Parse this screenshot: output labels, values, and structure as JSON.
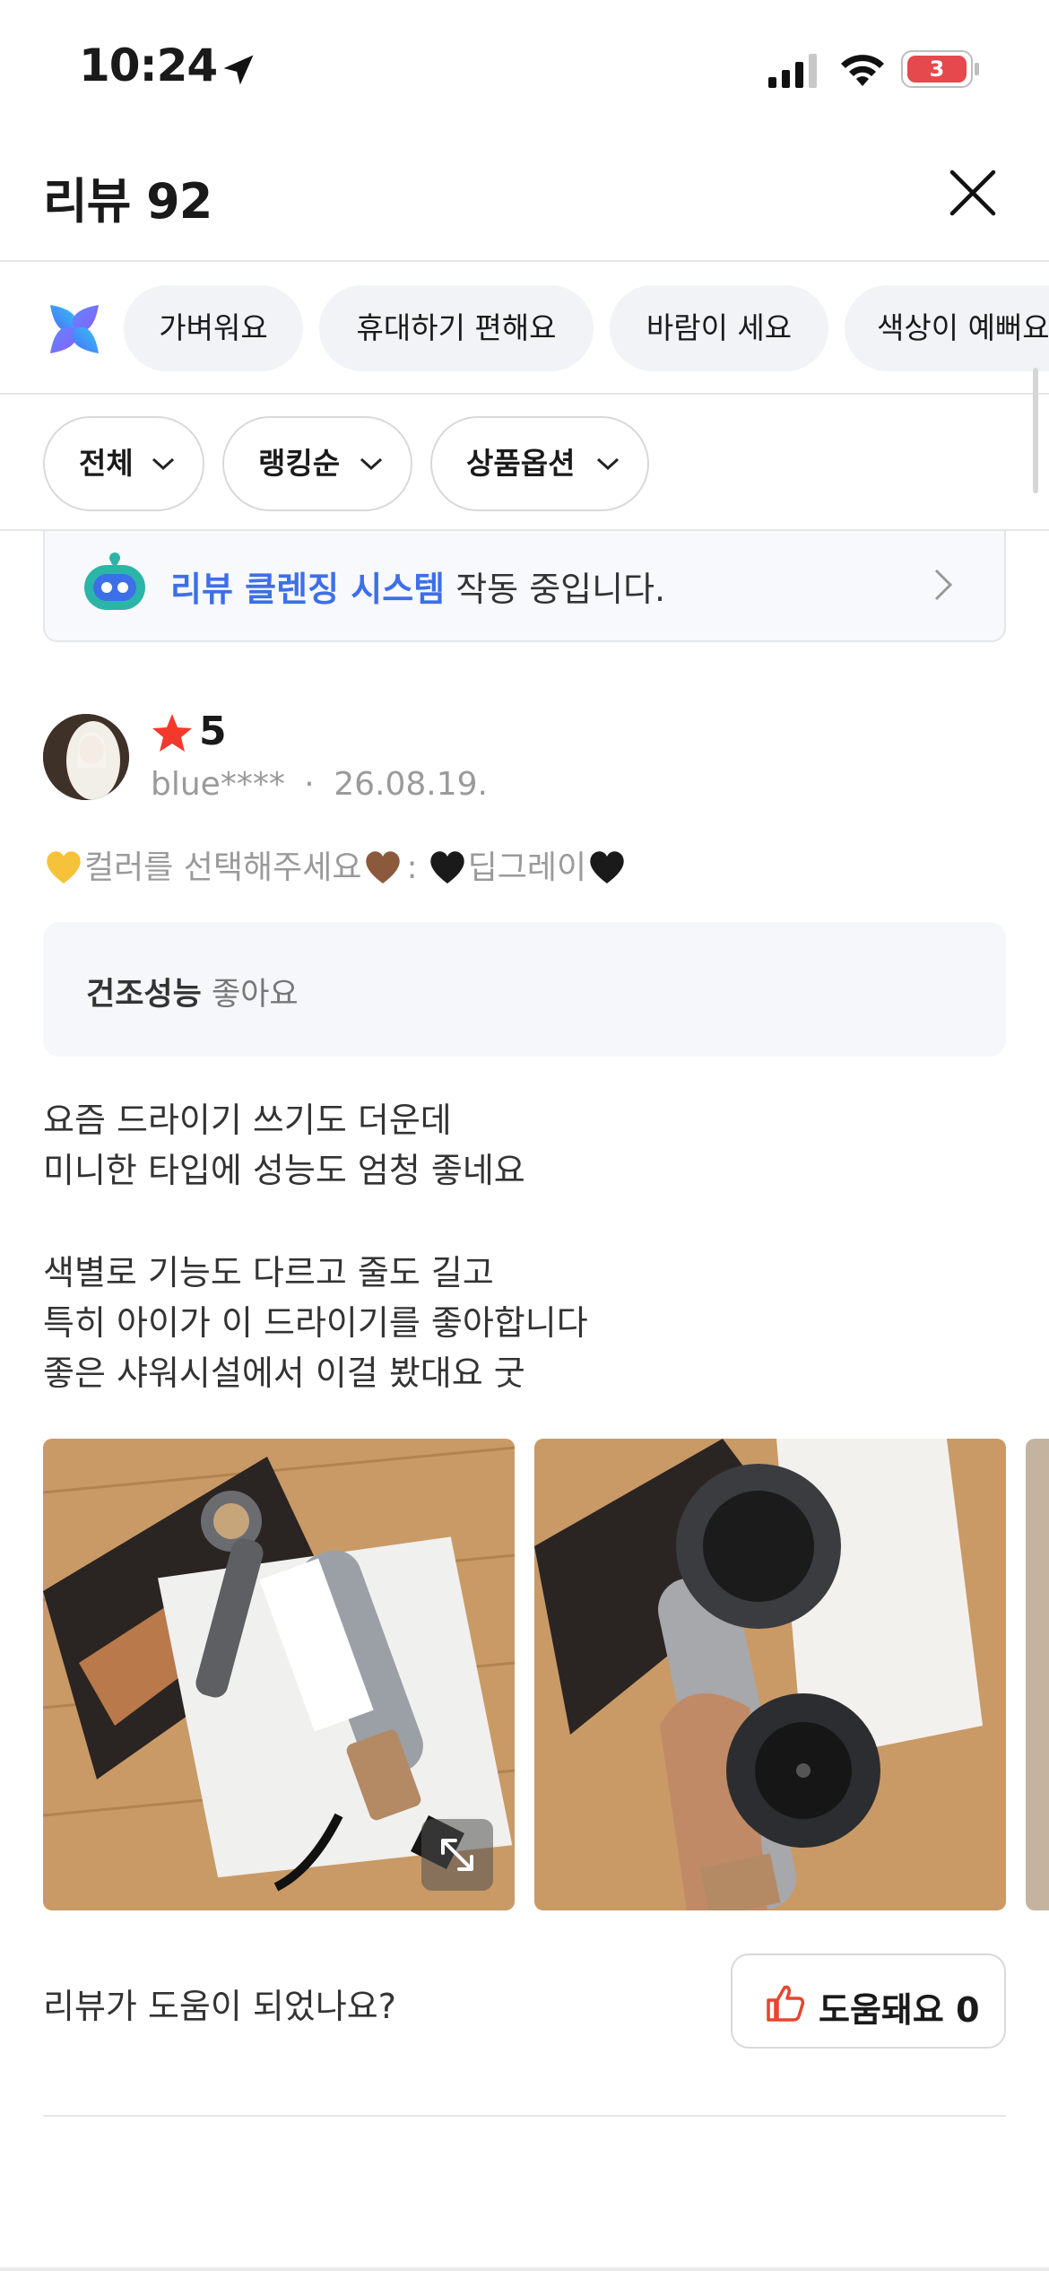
{
  "status_bar": {
    "time": "10:24",
    "battery": "3"
  },
  "header": {
    "title": "리뷰 92"
  },
  "keyword_chips": [
    "가벼워요",
    "휴대하기 편해요",
    "바람이 세요",
    "색상이 예뻐요"
  ],
  "filters": [
    "전체",
    "랭킹순",
    "상품옵션"
  ],
  "banner": {
    "highlight": "리뷰 클렌징 시스템",
    "text": " 작동 중입니다."
  },
  "review": {
    "rating": "5",
    "author": "blue****",
    "separator": "·",
    "date": "26.08.19.",
    "option_label": "컬러를 선택해주세요",
    "option_sep": ":",
    "option_value": "딥그레이",
    "eval_key": "건조성능",
    "eval_value": "좋아요",
    "body": [
      "요즘 드라이기 쓰기도 더운데",
      "미니한 타입에 성능도 엄청 좋네요",
      "",
      "색별로 기능도 다르고 줄도 길고",
      "특히 아이가 이 드라이기를 좋아합니다",
      "좋은 샤워시설에서 이걸 봤대요 굿"
    ]
  },
  "helpful": {
    "question": "리뷰가 도움이 되었나요?",
    "button_label": "도움돼요 0"
  },
  "colors": {
    "accent_blue": "#3d6fe8",
    "star_red": "#f2392b",
    "thumb_red": "#e8442e",
    "chip_bg": "#f1f3f6"
  }
}
